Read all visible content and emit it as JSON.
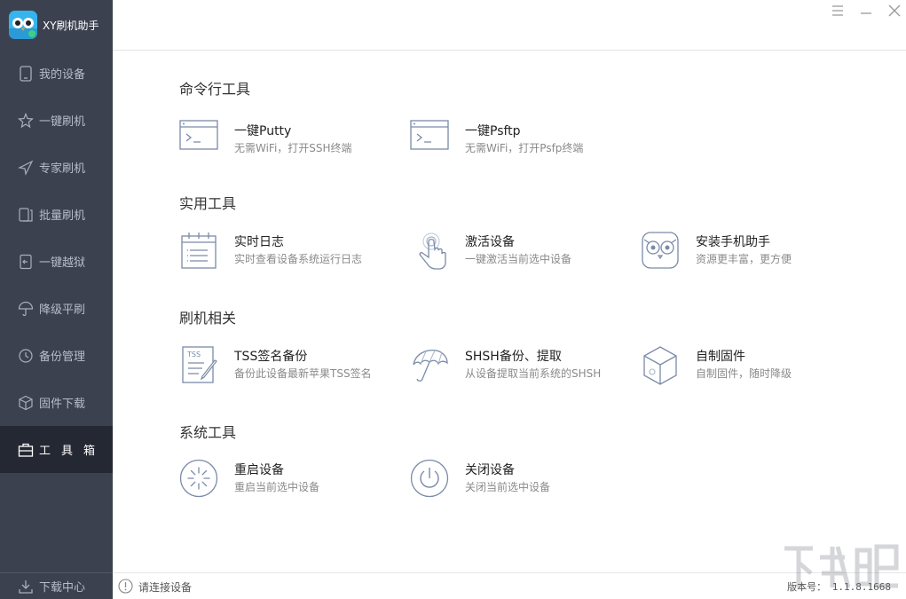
{
  "app": {
    "title": "XY刷机助手"
  },
  "sidebar": {
    "items": [
      {
        "label": "我的设备",
        "icon": "device-icon"
      },
      {
        "label": "一键刷机",
        "icon": "star-refresh-icon"
      },
      {
        "label": "专家刷机",
        "icon": "send-icon"
      },
      {
        "label": "批量刷机",
        "icon": "batch-device-icon"
      },
      {
        "label": "一键越狱",
        "icon": "jailbreak-icon"
      },
      {
        "label": "降级平刷",
        "icon": "umbrella-icon"
      },
      {
        "label": "备份管理",
        "icon": "backup-icon"
      },
      {
        "label": "固件下载",
        "icon": "cube-icon"
      },
      {
        "label": "工具箱",
        "icon": "toolbox-icon",
        "active": true
      }
    ],
    "bottom": {
      "label": "下载中心",
      "icon": "download-icon"
    }
  },
  "sections": [
    {
      "title": "命令行工具",
      "tools": [
        {
          "title": "一键Putty",
          "desc": "无需WiFi，打开SSH终端",
          "icon": "terminal-icon"
        },
        {
          "title": "一键Psftp",
          "desc": "无需WiFi，打开Psfp终端",
          "icon": "terminal-icon"
        }
      ]
    },
    {
      "title": "实用工具",
      "tools": [
        {
          "title": "实时日志",
          "desc": "实时查看设备系统运行日志",
          "icon": "log-icon"
        },
        {
          "title": "激活设备",
          "desc": "一键激活当前选中设备",
          "icon": "touch-icon"
        },
        {
          "title": "安装手机助手",
          "desc": "资源更丰富，更方便",
          "icon": "owl-icon"
        }
      ]
    },
    {
      "title": "刷机相关",
      "tools": [
        {
          "title": "TSS签名备份",
          "desc": "备份此设备最新苹果TSS签名",
          "icon": "tss-icon"
        },
        {
          "title": "SHSH备份、提取",
          "desc": "从设备提取当前系统的SHSH",
          "icon": "umbrella-icon"
        },
        {
          "title": "自制固件",
          "desc": "自制固件，随时降级",
          "icon": "cube-icon"
        }
      ]
    },
    {
      "title": "系统工具",
      "tools": [
        {
          "title": "重启设备",
          "desc": "重启当前选中设备",
          "icon": "restart-icon"
        },
        {
          "title": "关闭设备",
          "desc": "关闭当前选中设备",
          "icon": "power-icon"
        }
      ]
    }
  ],
  "status": {
    "message": "请连接设备",
    "version": "版本号： 1.1.8.1668"
  },
  "colors": {
    "sidebar_bg": "#3c4150",
    "sidebar_active": "#242833",
    "icon_stroke": "#7a8aa8"
  }
}
